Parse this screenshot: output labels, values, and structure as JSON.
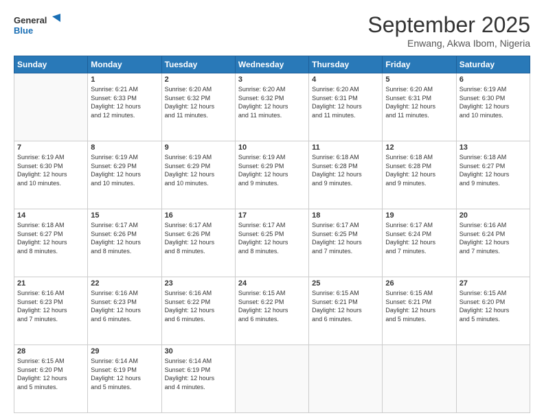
{
  "logo": {
    "line1": "General",
    "line2": "Blue"
  },
  "title": "September 2025",
  "subtitle": "Enwang, Akwa Ibom, Nigeria",
  "days_header": [
    "Sunday",
    "Monday",
    "Tuesday",
    "Wednesday",
    "Thursday",
    "Friday",
    "Saturday"
  ],
  "weeks": [
    [
      {
        "day": "",
        "info": ""
      },
      {
        "day": "1",
        "info": "Sunrise: 6:21 AM\nSunset: 6:33 PM\nDaylight: 12 hours\nand 12 minutes."
      },
      {
        "day": "2",
        "info": "Sunrise: 6:20 AM\nSunset: 6:32 PM\nDaylight: 12 hours\nand 11 minutes."
      },
      {
        "day": "3",
        "info": "Sunrise: 6:20 AM\nSunset: 6:32 PM\nDaylight: 12 hours\nand 11 minutes."
      },
      {
        "day": "4",
        "info": "Sunrise: 6:20 AM\nSunset: 6:31 PM\nDaylight: 12 hours\nand 11 minutes."
      },
      {
        "day": "5",
        "info": "Sunrise: 6:20 AM\nSunset: 6:31 PM\nDaylight: 12 hours\nand 11 minutes."
      },
      {
        "day": "6",
        "info": "Sunrise: 6:19 AM\nSunset: 6:30 PM\nDaylight: 12 hours\nand 10 minutes."
      }
    ],
    [
      {
        "day": "7",
        "info": "Sunrise: 6:19 AM\nSunset: 6:30 PM\nDaylight: 12 hours\nand 10 minutes."
      },
      {
        "day": "8",
        "info": "Sunrise: 6:19 AM\nSunset: 6:29 PM\nDaylight: 12 hours\nand 10 minutes."
      },
      {
        "day": "9",
        "info": "Sunrise: 6:19 AM\nSunset: 6:29 PM\nDaylight: 12 hours\nand 10 minutes."
      },
      {
        "day": "10",
        "info": "Sunrise: 6:19 AM\nSunset: 6:29 PM\nDaylight: 12 hours\nand 9 minutes."
      },
      {
        "day": "11",
        "info": "Sunrise: 6:18 AM\nSunset: 6:28 PM\nDaylight: 12 hours\nand 9 minutes."
      },
      {
        "day": "12",
        "info": "Sunrise: 6:18 AM\nSunset: 6:28 PM\nDaylight: 12 hours\nand 9 minutes."
      },
      {
        "day": "13",
        "info": "Sunrise: 6:18 AM\nSunset: 6:27 PM\nDaylight: 12 hours\nand 9 minutes."
      }
    ],
    [
      {
        "day": "14",
        "info": "Sunrise: 6:18 AM\nSunset: 6:27 PM\nDaylight: 12 hours\nand 8 minutes."
      },
      {
        "day": "15",
        "info": "Sunrise: 6:17 AM\nSunset: 6:26 PM\nDaylight: 12 hours\nand 8 minutes."
      },
      {
        "day": "16",
        "info": "Sunrise: 6:17 AM\nSunset: 6:26 PM\nDaylight: 12 hours\nand 8 minutes."
      },
      {
        "day": "17",
        "info": "Sunrise: 6:17 AM\nSunset: 6:25 PM\nDaylight: 12 hours\nand 8 minutes."
      },
      {
        "day": "18",
        "info": "Sunrise: 6:17 AM\nSunset: 6:25 PM\nDaylight: 12 hours\nand 7 minutes."
      },
      {
        "day": "19",
        "info": "Sunrise: 6:17 AM\nSunset: 6:24 PM\nDaylight: 12 hours\nand 7 minutes."
      },
      {
        "day": "20",
        "info": "Sunrise: 6:16 AM\nSunset: 6:24 PM\nDaylight: 12 hours\nand 7 minutes."
      }
    ],
    [
      {
        "day": "21",
        "info": "Sunrise: 6:16 AM\nSunset: 6:23 PM\nDaylight: 12 hours\nand 7 minutes."
      },
      {
        "day": "22",
        "info": "Sunrise: 6:16 AM\nSunset: 6:23 PM\nDaylight: 12 hours\nand 6 minutes."
      },
      {
        "day": "23",
        "info": "Sunrise: 6:16 AM\nSunset: 6:22 PM\nDaylight: 12 hours\nand 6 minutes."
      },
      {
        "day": "24",
        "info": "Sunrise: 6:15 AM\nSunset: 6:22 PM\nDaylight: 12 hours\nand 6 minutes."
      },
      {
        "day": "25",
        "info": "Sunrise: 6:15 AM\nSunset: 6:21 PM\nDaylight: 12 hours\nand 6 minutes."
      },
      {
        "day": "26",
        "info": "Sunrise: 6:15 AM\nSunset: 6:21 PM\nDaylight: 12 hours\nand 5 minutes."
      },
      {
        "day": "27",
        "info": "Sunrise: 6:15 AM\nSunset: 6:20 PM\nDaylight: 12 hours\nand 5 minutes."
      }
    ],
    [
      {
        "day": "28",
        "info": "Sunrise: 6:15 AM\nSunset: 6:20 PM\nDaylight: 12 hours\nand 5 minutes."
      },
      {
        "day": "29",
        "info": "Sunrise: 6:14 AM\nSunset: 6:19 PM\nDaylight: 12 hours\nand 5 minutes."
      },
      {
        "day": "30",
        "info": "Sunrise: 6:14 AM\nSunset: 6:19 PM\nDaylight: 12 hours\nand 4 minutes."
      },
      {
        "day": "",
        "info": ""
      },
      {
        "day": "",
        "info": ""
      },
      {
        "day": "",
        "info": ""
      },
      {
        "day": "",
        "info": ""
      }
    ]
  ]
}
